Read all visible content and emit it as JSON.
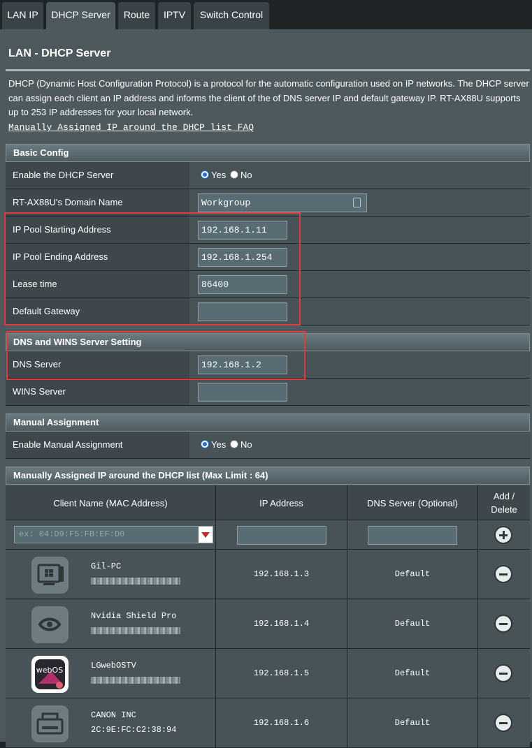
{
  "tabs": [
    "LAN IP",
    "DHCP Server",
    "Route",
    "IPTV",
    "Switch Control"
  ],
  "active_tab": "DHCP Server",
  "page_title": "LAN - DHCP Server",
  "description": "DHCP (Dynamic Host Configuration Protocol) is a protocol for the automatic configuration used on IP networks. The DHCP server can assign each client an IP address and informs the client of the of DNS server IP and default gateway IP. RT-AX88U supports up to 253 IP addresses for your local network.",
  "faq_link": "Manually Assigned IP around the DHCP list FAQ",
  "basic_config": {
    "title": "Basic Config",
    "enable_dhcp_label": "Enable the DHCP Server",
    "yes": "Yes",
    "no": "No",
    "domain_name_label": "RT-AX88U's Domain Name",
    "domain_name_value": "Workgroup",
    "ip_start_label": "IP Pool Starting Address",
    "ip_start_value": "192.168.1.11",
    "ip_end_label": "IP Pool Ending Address",
    "ip_end_value": "192.168.1.254",
    "lease_label": "Lease time",
    "lease_value": "86400",
    "gateway_label": "Default Gateway",
    "gateway_value": ""
  },
  "dns_wins": {
    "title": "DNS and WINS Server Setting",
    "dns_label": "DNS Server",
    "dns_value": "192.168.1.2",
    "wins_label": "WINS Server",
    "wins_value": ""
  },
  "manual_assignment": {
    "title": "Manual Assignment",
    "enable_label": "Enable Manual Assignment",
    "yes": "Yes",
    "no": "No"
  },
  "dhcp_list": {
    "title": "Manually Assigned IP around the DHCP list (Max Limit : 64)",
    "col_client": "Client Name (MAC Address)",
    "col_ip": "IP Address",
    "col_dns": "DNS Server (Optional)",
    "col_add_1": "Add /",
    "col_add_2": "Delete",
    "mac_placeholder": "ex: 04:D9:F5:FB:EF:D0",
    "rows": [
      {
        "name": "Gil-PC",
        "mac": "",
        "ip": "192.168.1.3",
        "dns": "Default",
        "icon": "windows-pc-icon"
      },
      {
        "name": "Nvidia Shield Pro",
        "mac": "",
        "ip": "192.168.1.4",
        "dns": "Default",
        "icon": "nvidia-icon"
      },
      {
        "name": "LGwebOSTV",
        "mac": "",
        "ip": "192.168.1.5",
        "dns": "Default",
        "icon": "webos-tv-icon"
      },
      {
        "name": "CANON INC",
        "mac": "2C:9E:FC:C2:38:94",
        "ip": "192.168.1.6",
        "dns": "Default",
        "icon": "printer-icon"
      }
    ]
  },
  "colors": {
    "highlight": "#e03c3c",
    "radio_selected": "#1d6fe0",
    "delete_button": "#c0302a"
  }
}
